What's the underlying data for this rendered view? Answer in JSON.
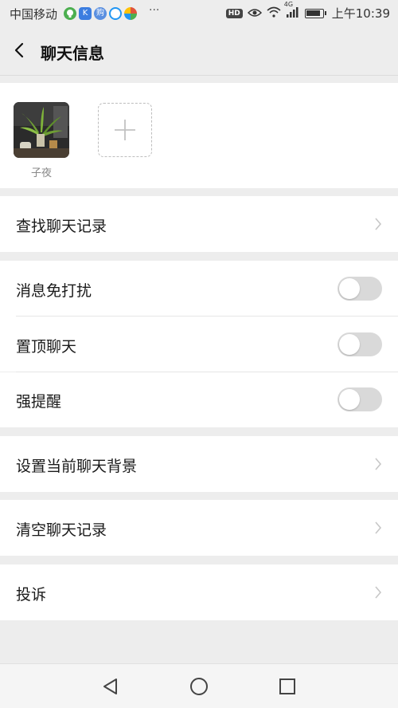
{
  "status_bar": {
    "carrier": "中国移动",
    "app_icons": [
      {
        "name": "wechat-lightbulb-icon",
        "color": "#4caf50",
        "glyph": "♦"
      },
      {
        "name": "k-app-icon",
        "color": "#3b7de0",
        "glyph": "K"
      },
      {
        "name": "purchase-app-icon",
        "color": "#5a8fe0",
        "glyph": "购"
      },
      {
        "name": "circle-app-icon",
        "color": "#2196f3",
        "glyph": "◐"
      },
      {
        "name": "colorful-app-icon",
        "color": "#e0543b",
        "glyph": "◎"
      }
    ],
    "more": "···",
    "hd": "HD",
    "network": "4G",
    "time": "上午10:39"
  },
  "header": {
    "title": "聊天信息"
  },
  "members": [
    {
      "name": "子夜"
    }
  ],
  "rows": {
    "search_history": "查找聊天记录",
    "mute": "消息免打扰",
    "sticky": "置顶聊天",
    "strong_reminder": "强提醒",
    "set_background": "设置当前聊天背景",
    "clear_history": "清空聊天记录",
    "report": "投诉"
  },
  "toggles": {
    "mute": false,
    "sticky": false,
    "strong_reminder": false
  },
  "colors": {
    "background": "#ededed",
    "panel": "#ffffff",
    "toggle_off": "#d9d9d9",
    "chevron": "#c7c7c7"
  }
}
